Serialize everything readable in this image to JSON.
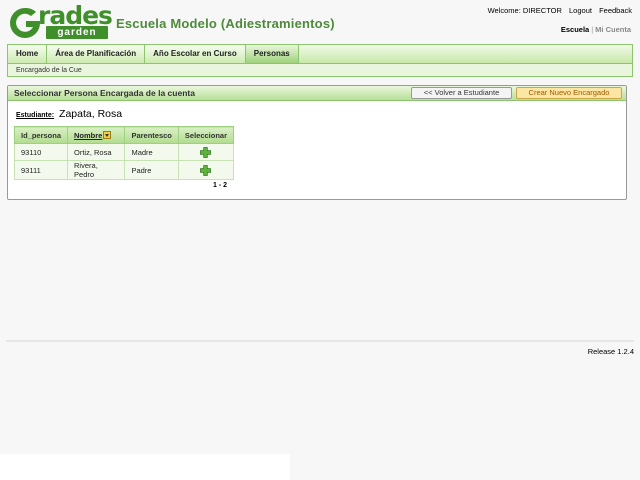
{
  "brand": {
    "logo_main": "rades",
    "logo_sub": "garden"
  },
  "header": {
    "school_name": "Escuela Modelo (Adiestramientos)",
    "welcome": "Welcome: DIRECTOR",
    "logout": "Logout",
    "feedback": "Feedback",
    "school_link": "Escuela",
    "separator": "|",
    "account_link": "Mi Cuenta"
  },
  "tabs": [
    {
      "label": "Home"
    },
    {
      "label": "Área de Planificación"
    },
    {
      "label": "Año Escolar en Curso"
    },
    {
      "label": "Personas"
    }
  ],
  "subnav": {
    "label": "Encargado de la Cue"
  },
  "panel": {
    "title": "Seleccionar Persona Encargada de la cuenta",
    "back_button": "<< Volver a Estudiante",
    "new_button": "Crear Nuevo Encargado",
    "student_label": "Estudiante:",
    "student_name": "Zapata, Rosa"
  },
  "table": {
    "headers": [
      "Id_persona",
      "Nombre",
      "Parentesco",
      "Seleccionar"
    ],
    "rows": [
      {
        "id": "93110",
        "name": "Ortiz, Rosa",
        "relation": "Madre"
      },
      {
        "id": "93111",
        "name": "Rivera, Pedro",
        "relation": "Padre"
      }
    ],
    "pager": "1 - 2"
  },
  "footer": {
    "release": "Release 1.2.4"
  },
  "colors": {
    "accent_green": "#4d8a3a",
    "tab_border": "#8bc56d",
    "new_button_bg": "#fbe6a3"
  }
}
